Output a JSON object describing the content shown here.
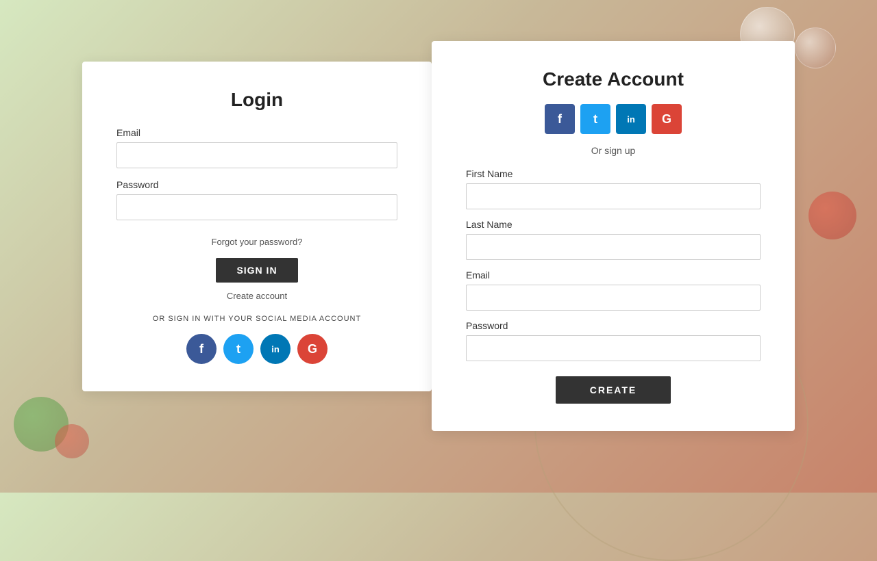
{
  "background": {
    "color_start": "#d6e8c0",
    "color_end": "#c8836a"
  },
  "login": {
    "title": "Login",
    "email_label": "Email",
    "email_placeholder": "",
    "password_label": "Password",
    "password_placeholder": "",
    "forgot_password_text": "Forgot your password?",
    "sign_in_button": "SIGN IN",
    "create_account_link": "Create account",
    "divider_text": "OR SIGN IN WITH YOUR SOCIAL MEDIA ACCOUNT",
    "social": {
      "facebook_label": "f",
      "twitter_label": "t",
      "linkedin_label": "in",
      "google_label": "G"
    }
  },
  "create_account": {
    "title": "Create Account",
    "or_signup_text": "Or sign up",
    "first_name_label": "First Name",
    "first_name_placeholder": "",
    "last_name_label": "Last Name",
    "last_name_placeholder": "",
    "email_label": "Email",
    "email_placeholder": "",
    "password_label": "Password",
    "password_placeholder": "",
    "create_button": "CREATE",
    "social": {
      "facebook_label": "f",
      "twitter_label": "t",
      "linkedin_label": "in",
      "google_label": "G"
    }
  }
}
